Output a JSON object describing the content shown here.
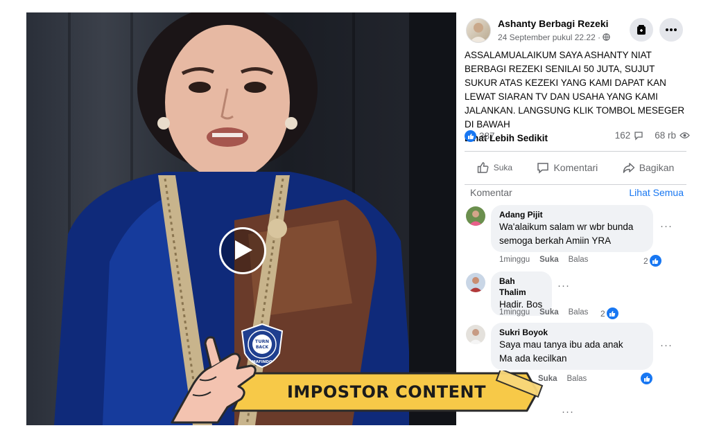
{
  "post": {
    "page_name": "Ashanty Berbagi Rezeki",
    "date": "24 September pukul 22.22 ·",
    "body": "ASSALAMUALAIKUM SAYA ASHANTY NIAT BERBAGI REZEKI SENILAI 50 JUTA, SUJUT SUKUR ATAS KEZEKI YANG KAMI DAPAT KAN LEWAT SIARAN TV DAN USAHA YANG KAMI JALANKAN. LANGSUNG KLIK TOMBOL MESEGER DI BAWAH",
    "see_less": "Lihat Lebih Sedikit",
    "reactions": "387",
    "comments_count": "162",
    "views": "68 rb"
  },
  "actions": {
    "like": "Suka",
    "comment": "Komentari",
    "share": "Bagikan"
  },
  "comments_section": {
    "heading": "Komentar",
    "see_all": "Lihat Semua"
  },
  "comments": [
    {
      "name": "Adang Pijit",
      "text_line1": "Wa'alaikum salam wr wbr bunda",
      "text_line2": "semoga berkah Amiin YRA",
      "time": "1minggu",
      "like": "Suka",
      "reply": "Balas",
      "reactions": "2"
    },
    {
      "name": "Bah Thalim",
      "text_line1": "Hadir. Bos",
      "time": "1minggu",
      "like": "Suka",
      "reply": "Balas",
      "reactions": "2"
    },
    {
      "name": "Sukri Boyok",
      "text_line1": "Saya mau tanya ibu ada anak",
      "text_line2": "Ma   ada kecilkan",
      "like": "Suka",
      "reply": "Balas"
    }
  ],
  "overlay": {
    "banner_text": "IMPOSTOR CONTENT",
    "badge_text": "TURN BACK HOAX",
    "badge_ring_text": "MASYARAKAT ANTI FITNAH INDONESIA",
    "badge_bottom": "MAFINDO"
  },
  "colors": {
    "accent_blue": "#1877f2",
    "banner_yellow": "#f7c948",
    "secondary_text": "#65676b"
  }
}
